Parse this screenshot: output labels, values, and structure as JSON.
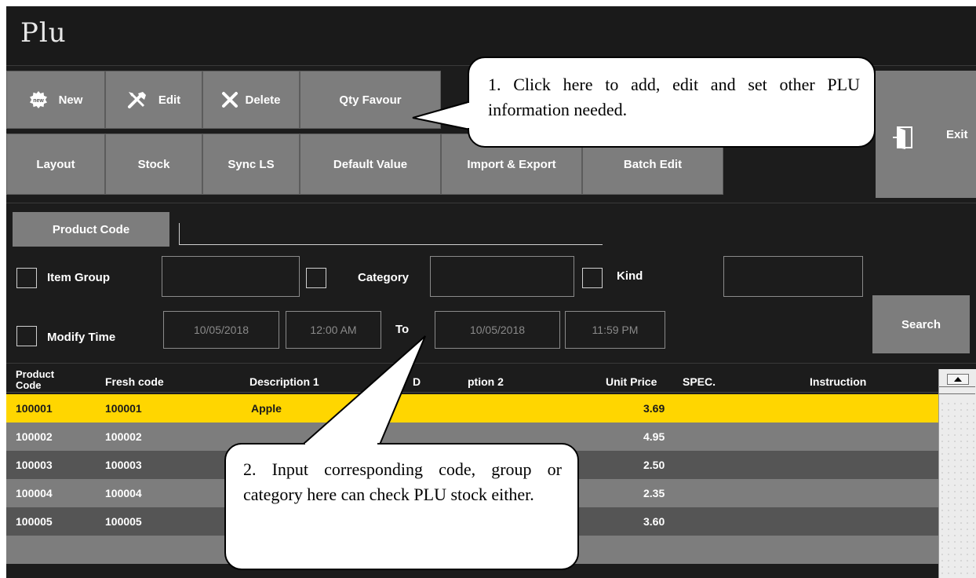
{
  "window": {
    "title": "Plu"
  },
  "toolbar": {
    "row1": [
      {
        "label": "New",
        "icon": "new-badge-icon"
      },
      {
        "label": "Edit",
        "icon": "tools-icon"
      },
      {
        "label": "Delete",
        "icon": "x-icon"
      },
      {
        "label": "Qty Favour"
      }
    ],
    "row2": [
      {
        "label": "Layout"
      },
      {
        "label": "Stock"
      },
      {
        "label": "Sync LS"
      },
      {
        "label": "Default Value"
      },
      {
        "label": "Import & Export"
      },
      {
        "label": "Batch Edit"
      }
    ],
    "exit": {
      "label": "Exit",
      "icon": "exit-door-icon"
    }
  },
  "filters": {
    "product_code_label": "Product Code",
    "product_code_value": "",
    "item_group_label": "Item Group",
    "item_group_value": "",
    "category_label": "Category",
    "category_value": "",
    "kind_label": "Kind",
    "kind_value": "",
    "modify_time_label": "Modify Time",
    "from_date": "10/05/2018",
    "from_time": "12:00 AM",
    "to_label": "To",
    "to_date": "10/05/2018",
    "to_time": "11:59 PM",
    "search_label": "Search"
  },
  "table": {
    "columns": {
      "product_code_line1": "Product",
      "product_code_line2": "Code",
      "fresh_code": "Fresh code",
      "description1": "Description 1",
      "description2_start": "D",
      "description2_end": "ption 2",
      "unit_price": "Unit Price",
      "spec": "SPEC.",
      "instruction": "Instruction"
    },
    "rows": [
      {
        "product_code": "100001",
        "fresh_code": "100001",
        "description1": "Apple",
        "unit_price": "3.69"
      },
      {
        "product_code": "100002",
        "fresh_code": "100002",
        "description1": "",
        "unit_price": "4.95"
      },
      {
        "product_code": "100003",
        "fresh_code": "100003",
        "description1": "",
        "unit_price": "2.50"
      },
      {
        "product_code": "100004",
        "fresh_code": "100004",
        "description1": "",
        "unit_price": "2.35"
      },
      {
        "product_code": "100005",
        "fresh_code": "100005",
        "description1": "",
        "unit_price": "3.60"
      }
    ],
    "selected_row": 0
  },
  "annotations": {
    "callout1": "1. Click here to add, edit and set other PLU information needed.",
    "callout2": "2. Input corresponding code, group or category here can check PLU stock either."
  },
  "colors": {
    "background": "#1c1c1c",
    "button": "#7d7d7d",
    "selected_row": "#ffd600",
    "row_light": "#7d7d7d",
    "row_dark": "#555555"
  }
}
